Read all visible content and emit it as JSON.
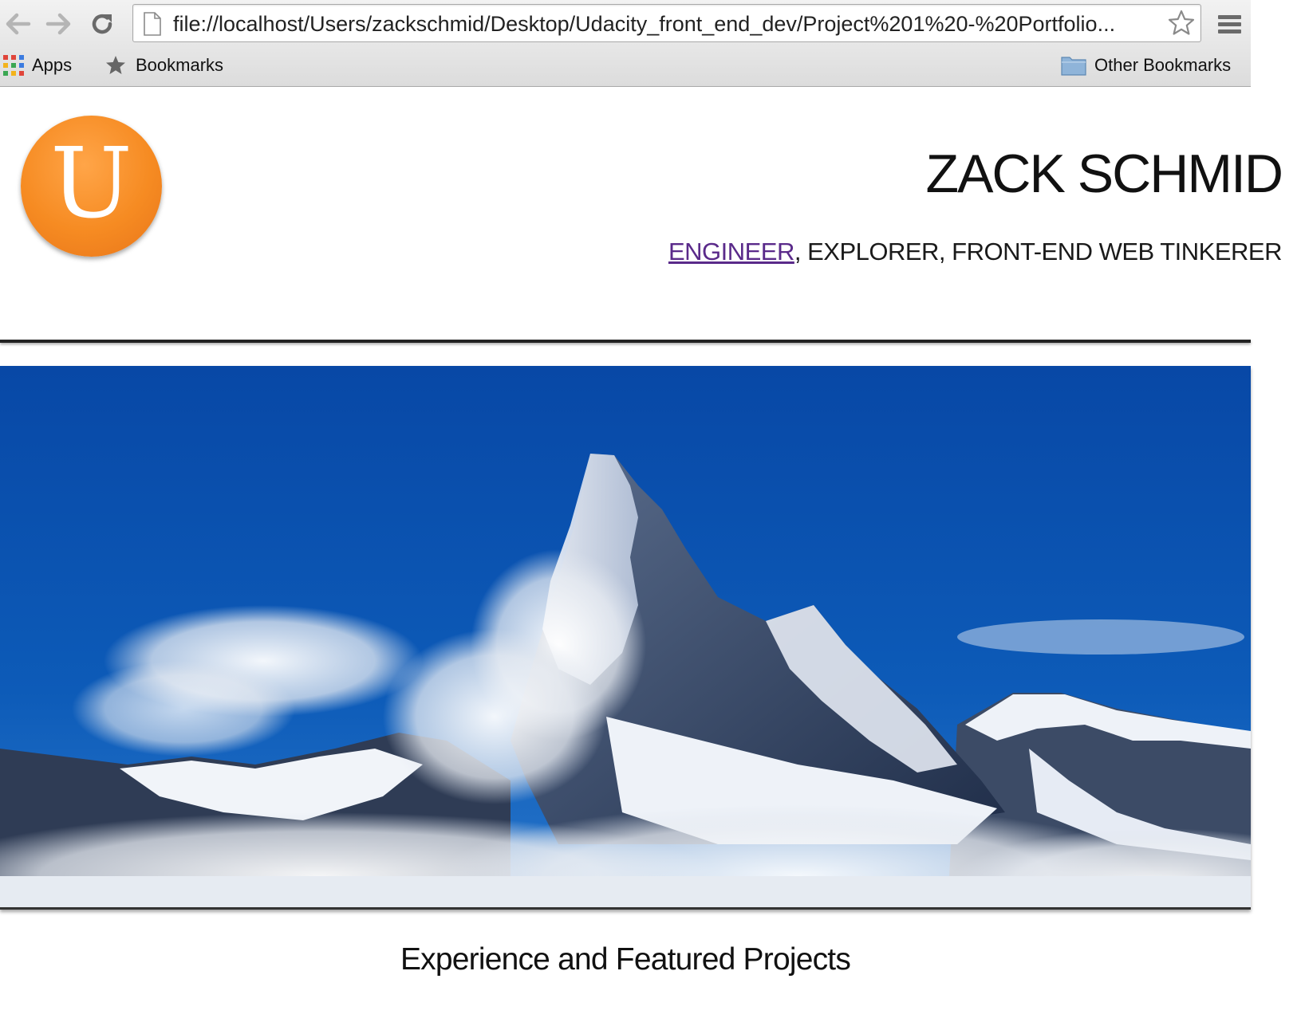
{
  "browser": {
    "url": "file://localhost/Users/zackschmid/Desktop/Udacity_front_end_dev/Project%201%20-%20Portfolio...",
    "bookmarks_bar": {
      "apps_label": "Apps",
      "bookmarks_label": "Bookmarks",
      "other_bookmarks_label": "Other Bookmarks"
    },
    "icons": [
      "back-arrow-icon",
      "forward-arrow-icon",
      "reload-icon",
      "page-icon",
      "bookmark-star-icon",
      "chrome-menu-icon",
      "apps-grid-icon",
      "bookmarks-star-icon",
      "folder-icon"
    ]
  },
  "header": {
    "logo_letter": "U",
    "name": "ZACK SCHMID",
    "tagline_link": "ENGINEER",
    "tagline_rest": ", EXPLORER, FRONT-END WEB TINKERER"
  },
  "main": {
    "section_title": "Experience and Featured Projects"
  },
  "colors": {
    "logo_orange": "#f68b22",
    "link_purple": "#5a2a8a",
    "sky_blue": "#0d5bb8"
  }
}
